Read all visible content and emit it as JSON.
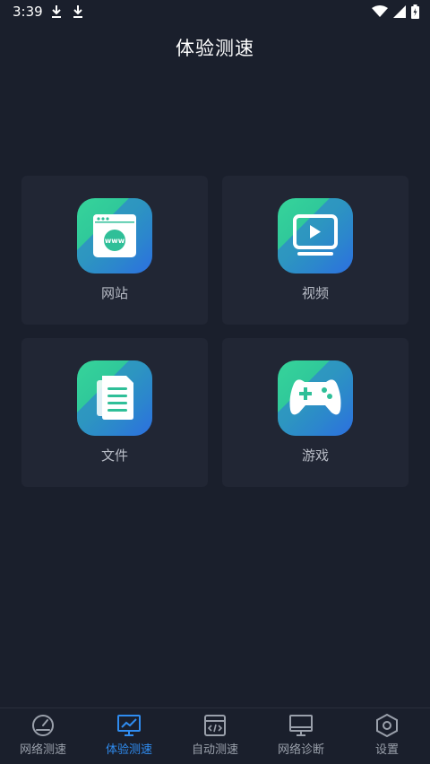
{
  "status_bar": {
    "time": "3:39",
    "icons": [
      "download-icon",
      "download-icon",
      "wifi-icon",
      "signal-icon",
      "battery-icon"
    ]
  },
  "header": {
    "title": "体验测速"
  },
  "categories": [
    {
      "label": "网站",
      "icon": "website-icon"
    },
    {
      "label": "视频",
      "icon": "video-icon"
    },
    {
      "label": "文件",
      "icon": "file-icon"
    },
    {
      "label": "游戏",
      "icon": "gamepad-icon"
    }
  ],
  "bottom_nav": {
    "active_index": 1,
    "active_color": "#2f8cf0",
    "items": [
      {
        "label": "网络测速",
        "icon": "speedometer-icon"
      },
      {
        "label": "体验测速",
        "icon": "monitor-chart-icon"
      },
      {
        "label": "自动测速",
        "icon": "code-window-icon"
      },
      {
        "label": "网络诊断",
        "icon": "monitor-icon"
      },
      {
        "label": "设置",
        "icon": "hexagon-settings-icon"
      }
    ]
  },
  "colors": {
    "background": "#1a1f2c",
    "card": "#212634",
    "icon_gradient_start": "#36d49a",
    "icon_gradient_end": "#2d6fe0"
  }
}
